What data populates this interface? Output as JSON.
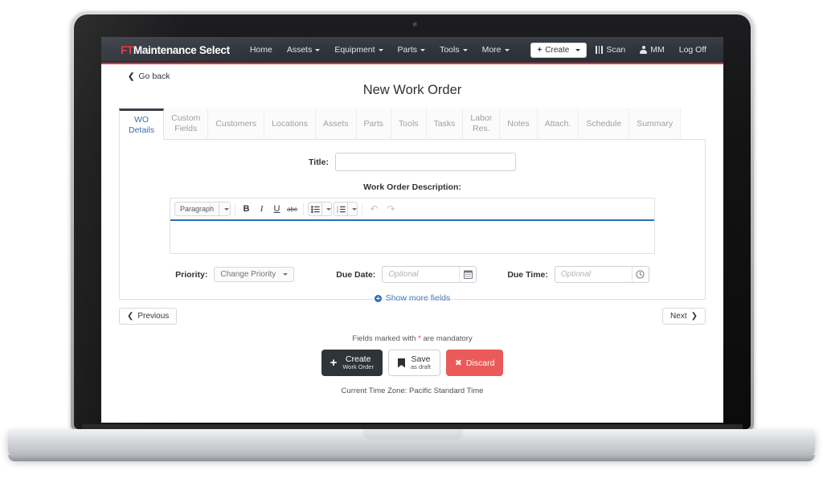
{
  "navbar": {
    "brand_mark": "FT",
    "brand_rest": "Maintenance Select",
    "links": [
      {
        "label": "Home",
        "caret": false
      },
      {
        "label": "Assets",
        "caret": true
      },
      {
        "label": "Equipment",
        "caret": true
      },
      {
        "label": "Parts",
        "caret": true
      },
      {
        "label": "Tools",
        "caret": true
      },
      {
        "label": "More",
        "caret": true
      }
    ],
    "create_label": "Create",
    "create_plus": "+",
    "scan_label": "Scan",
    "user_label": "MM",
    "logoff_label": "Log Off",
    "accent_color": "#e8333f",
    "bar_color": "#2f343b"
  },
  "page": {
    "go_back": "Go back",
    "title": "New Work Order"
  },
  "tabs": [
    {
      "label": "WO\nDetails",
      "active": true
    },
    {
      "label": "Custom\nFields",
      "active": false
    },
    {
      "label": "Customers",
      "active": false
    },
    {
      "label": "Locations",
      "active": false
    },
    {
      "label": "Assets",
      "active": false
    },
    {
      "label": "Parts",
      "active": false
    },
    {
      "label": "Tools",
      "active": false
    },
    {
      "label": "Tasks",
      "active": false
    },
    {
      "label": "Labor\nRes.",
      "active": false
    },
    {
      "label": "Notes",
      "active": false
    },
    {
      "label": "Attach.",
      "active": false
    },
    {
      "label": "Schedule",
      "active": false
    },
    {
      "label": "Summary",
      "active": false
    }
  ],
  "form": {
    "title_label": "Title:",
    "title_value": "",
    "description_label": "Work Order Description:",
    "description_value": "",
    "editor": {
      "format_label": "Paragraph",
      "bold": "B",
      "italic": "I",
      "underline": "U",
      "strikethrough": "abc",
      "bullet_list": "☰",
      "numbered_list": "☰",
      "undo": "↶",
      "redo": "↷"
    },
    "priority_label": "Priority:",
    "priority_value": "Change Priority",
    "due_date_label": "Due Date:",
    "due_date_placeholder": "Optional",
    "due_date_value": "",
    "due_time_label": "Due Time:",
    "due_time_placeholder": "Optional",
    "due_time_value": "",
    "show_more": "Show more fields"
  },
  "pager": {
    "previous": "Previous",
    "next": "Next"
  },
  "footer": {
    "mandatory_prefix": "Fields marked with ",
    "mandatory_star": "*",
    "mandatory_suffix": " are mandatory",
    "create_main": "Create",
    "create_sub": "Work Order",
    "save_main": "Save",
    "save_sub": "as draft",
    "discard_label": "Discard",
    "discard_icon": "✖",
    "timezone": "Current Time Zone: Pacific Standard Time"
  }
}
